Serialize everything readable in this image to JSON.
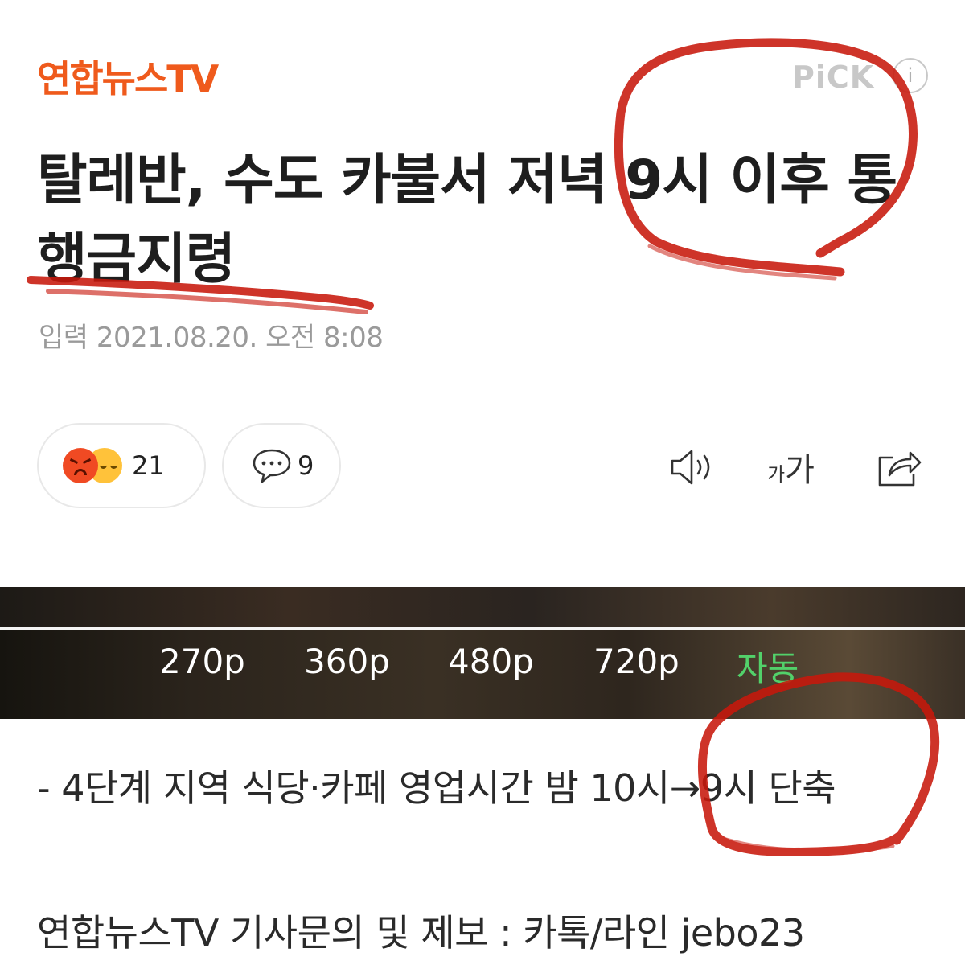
{
  "header": {
    "brand": "연합뉴스TV",
    "pick_label": "PiCK",
    "info_icon": "info-icon",
    "info_glyph": "i"
  },
  "article": {
    "headline": "탈레반, 수도 카불서 저녁 9시 이후 통행금지령",
    "timestamp": "입력 2021.08.20. 오전 8:08"
  },
  "actions": {
    "reaction_count": "21",
    "reaction_icons": [
      "angry-face-icon",
      "sad-face-icon"
    ],
    "comment_count": "9",
    "comment_icon": "speech-bubble-icon",
    "speaker_icon": "speaker-icon",
    "font_size_small": "가",
    "font_size_large": "가",
    "share_icon": "share-icon"
  },
  "video": {
    "quality_options": [
      "270p",
      "360p",
      "480p",
      "720p",
      "자동"
    ],
    "selected_quality": "자동",
    "active_color": "#52d16a"
  },
  "body": {
    "summary_line": "- 4단계 지역 식당·카페 영업시간 밤 10시→9시 단축",
    "footer_line": "연합뉴스TV 기사문의 및 제보 : 카톡/라인 jebo23"
  },
  "colors": {
    "brand": "#ef5a1c",
    "annotation": "#c8180c",
    "muted_text": "#9a9a9a"
  }
}
